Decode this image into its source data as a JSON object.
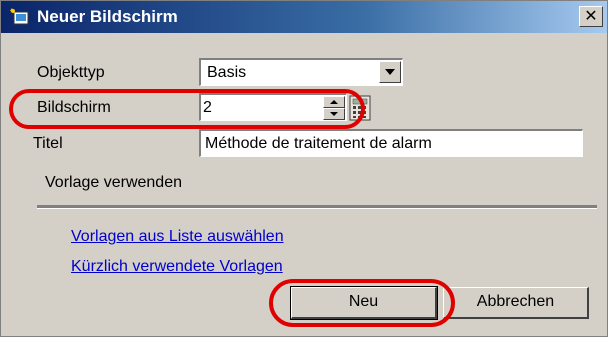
{
  "dialog": {
    "title": "Neuer Bildschirm",
    "close_glyph": "✕"
  },
  "form": {
    "objekttyp_label": "Objekttyp",
    "objekttyp_value": "Basis",
    "bildschirm_label": "Bildschirm",
    "bildschirm_value": "2",
    "titel_label": "Titel",
    "titel_value": "Méthode de traitement de alarm",
    "vorlage_label": "Vorlage verwenden"
  },
  "links": {
    "from_list": "Vorlagen aus Liste auswählen",
    "recent": "Kürzlich verwendete Vorlagen"
  },
  "buttons": {
    "new": "Neu",
    "cancel": "Abbrechen"
  },
  "colors": {
    "highlight": "#e00000",
    "titlebar": "#0a246a",
    "link": "#0000cc",
    "dialog_bg": "#d4d0c8"
  },
  "icons": {
    "app": "new-screen-icon",
    "calculator": "calculator-icon"
  }
}
